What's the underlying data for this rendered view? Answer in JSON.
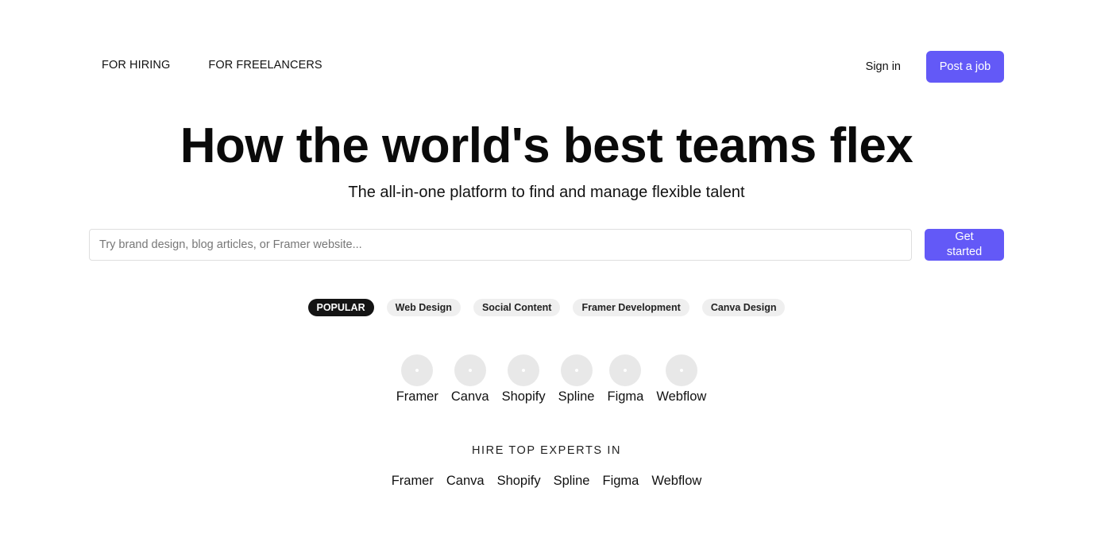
{
  "header": {
    "nav_links": [
      "FOR HIRING",
      "FOR FREELANCERS"
    ],
    "sign_in_label": "Sign in",
    "post_job_label": "Post a job"
  },
  "hero": {
    "title": "How the world's best teams flex",
    "subtitle": "The all-in-one platform to find and manage flexible talent"
  },
  "search": {
    "value": "",
    "placeholder": "Try brand design, blog articles, or Framer website...",
    "button_label": "Get started"
  },
  "tags": [
    {
      "label": "POPULAR",
      "active": true
    },
    {
      "label": "Web Design",
      "active": false
    },
    {
      "label": "Social Content",
      "active": false
    },
    {
      "label": "Framer Development",
      "active": false
    },
    {
      "label": "Canva Design",
      "active": false
    }
  ],
  "tools": [
    {
      "label": "Framer",
      "icon": "framer-icon"
    },
    {
      "label": "Canva",
      "icon": "canva-icon"
    },
    {
      "label": "Shopify",
      "icon": "shopify-icon"
    },
    {
      "label": "Spline",
      "icon": "spline-icon"
    },
    {
      "label": "Figma",
      "icon": "figma-icon"
    },
    {
      "label": "Webflow",
      "icon": "webflow-icon"
    }
  ],
  "experts": {
    "heading": "HIRE TOP EXPERTS IN",
    "links": [
      "Framer",
      "Canva",
      "Shopify",
      "Spline",
      "Figma",
      "Webflow"
    ]
  },
  "colors": {
    "accent": "#6359f7",
    "tag_active_bg": "#141414",
    "tag_bg": "#efefef",
    "icon_placeholder": "#e8e8e8"
  }
}
